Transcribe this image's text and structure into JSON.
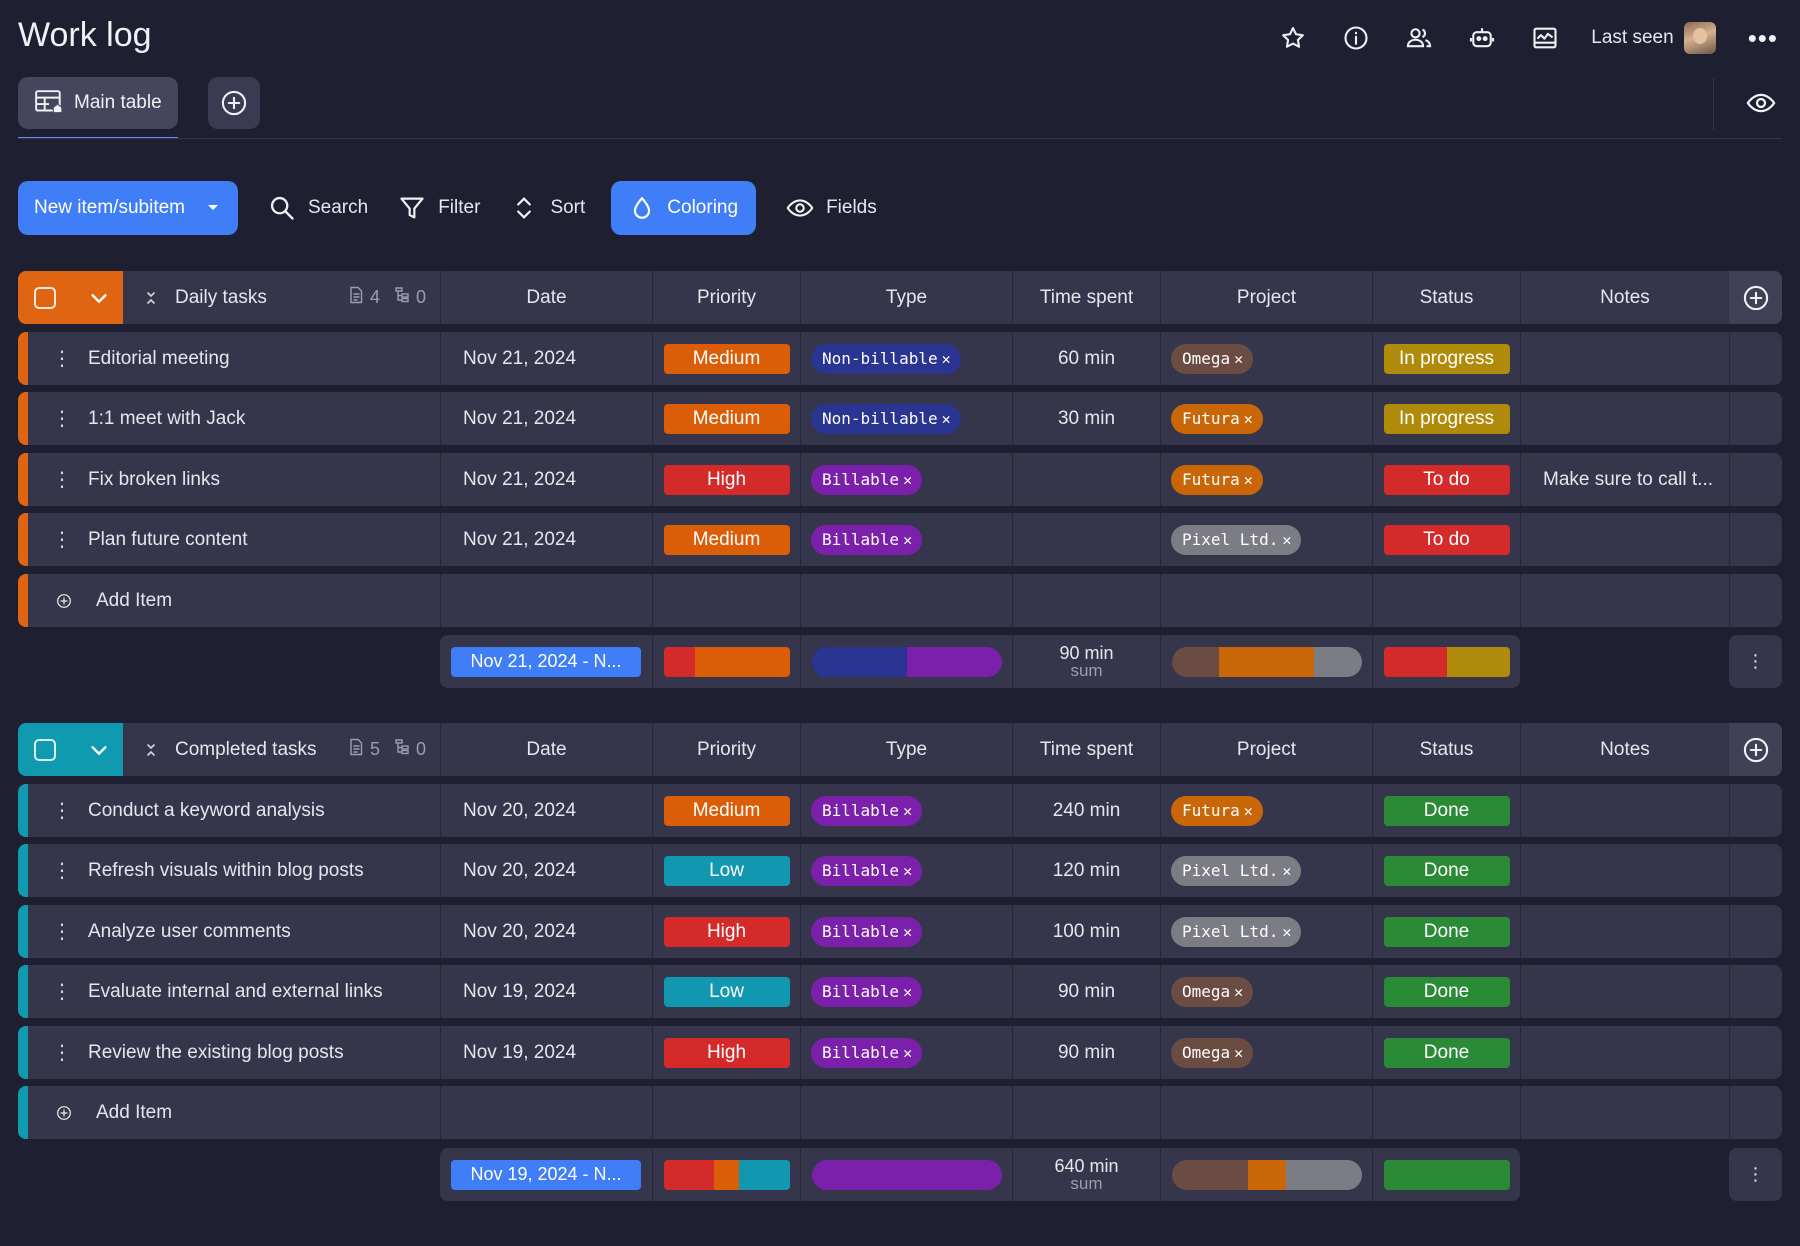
{
  "header": {
    "title": "Work log",
    "last_seen_label": "Last seen"
  },
  "tabs": {
    "main_label": "Main table"
  },
  "toolbar": {
    "new_label": "New item/subitem",
    "search_label": "Search",
    "filter_label": "Filter",
    "sort_label": "Sort",
    "coloring_label": "Coloring",
    "fields_label": "Fields"
  },
  "columns": {
    "date": "Date",
    "priority": "Priority",
    "type": "Type",
    "time_spent": "Time spent",
    "project": "Project",
    "status": "Status",
    "notes": "Notes"
  },
  "colors": {
    "medium": "#dc5d07",
    "high": "#d42a2a",
    "low": "#1197b0",
    "nonbillable": "#2a3491",
    "billable": "#7b20aa",
    "omega": "#6b4c42",
    "futura": "#c96608",
    "pixel": "#7b7c84",
    "in_progress": "#b08a0a",
    "todo": "#d42a2a",
    "done": "#2a8a36",
    "daily_accent": "#e06512",
    "completed_accent": "#0f9ab0"
  },
  "groups": [
    {
      "name": "Daily tasks",
      "doc_count": "4",
      "sub_count": "0",
      "add_label": "Add Item",
      "rows": [
        {
          "name": "Editorial meeting",
          "date": "Nov 21, 2024",
          "priority": "Medium",
          "type": "Non-billable",
          "time": "60 min",
          "project": "Omega",
          "status": "In progress",
          "notes": ""
        },
        {
          "name": "1:1 meet with Jack",
          "date": "Nov 21, 2024",
          "priority": "Medium",
          "type": "Non-billable",
          "time": "30 min",
          "project": "Futura",
          "status": "In progress",
          "notes": ""
        },
        {
          "name": "Fix broken links",
          "date": "Nov 21, 2024",
          "priority": "High",
          "type": "Billable",
          "time": "",
          "project": "Futura",
          "status": "To do",
          "notes": "Make sure to call t..."
        },
        {
          "name": "Plan future content",
          "date": "Nov 21, 2024",
          "priority": "Medium",
          "type": "Billable",
          "time": "",
          "project": "Pixel Ltd.",
          "status": "To do",
          "notes": ""
        }
      ],
      "summary": {
        "date_range": "Nov 21, 2024 - N...",
        "time_sum": "90 min",
        "time_sum_label": "sum",
        "priority_dist": [
          {
            "key": "high",
            "share": 1
          },
          {
            "key": "medium",
            "share": 3
          }
        ],
        "type_dist": [
          {
            "key": "nonbillable",
            "share": 2
          },
          {
            "key": "billable",
            "share": 2
          }
        ],
        "project_dist": [
          {
            "key": "omega",
            "share": 1
          },
          {
            "key": "futura",
            "share": 2
          },
          {
            "key": "pixel",
            "share": 1
          }
        ],
        "status_dist": [
          {
            "key": "todo",
            "share": 2
          },
          {
            "key": "in_progress",
            "share": 2
          }
        ]
      }
    },
    {
      "name": "Completed tasks",
      "doc_count": "5",
      "sub_count": "0",
      "add_label": "Add Item",
      "rows": [
        {
          "name": "Conduct a keyword analysis",
          "date": "Nov 20, 2024",
          "priority": "Medium",
          "type": "Billable",
          "time": "240 min",
          "project": "Futura",
          "status": "Done",
          "notes": ""
        },
        {
          "name": "Refresh visuals within blog posts",
          "date": "Nov 20, 2024",
          "priority": "Low",
          "type": "Billable",
          "time": "120 min",
          "project": "Pixel Ltd.",
          "status": "Done",
          "notes": ""
        },
        {
          "name": "Analyze user comments",
          "date": "Nov 20, 2024",
          "priority": "High",
          "type": "Billable",
          "time": "100 min",
          "project": "Pixel Ltd.",
          "status": "Done",
          "notes": ""
        },
        {
          "name": "Evaluate internal and external links",
          "date": "Nov 19, 2024",
          "priority": "Low",
          "type": "Billable",
          "time": "90 min",
          "project": "Omega",
          "status": "Done",
          "notes": ""
        },
        {
          "name": "Review the existing blog posts",
          "date": "Nov 19, 2024",
          "priority": "High",
          "type": "Billable",
          "time": "90 min",
          "project": "Omega",
          "status": "Done",
          "notes": ""
        }
      ],
      "summary": {
        "date_range": "Nov 19, 2024 - N...",
        "time_sum": "640 min",
        "time_sum_label": "sum",
        "priority_dist": [
          {
            "key": "high",
            "share": 2
          },
          {
            "key": "medium",
            "share": 1
          },
          {
            "key": "low",
            "share": 2
          }
        ],
        "type_dist": [
          {
            "key": "billable",
            "share": 5
          }
        ],
        "project_dist": [
          {
            "key": "omega",
            "share": 2
          },
          {
            "key": "futura",
            "share": 1
          },
          {
            "key": "pixel",
            "share": 2
          }
        ],
        "status_dist": [
          {
            "key": "done",
            "share": 5
          }
        ]
      }
    }
  ]
}
